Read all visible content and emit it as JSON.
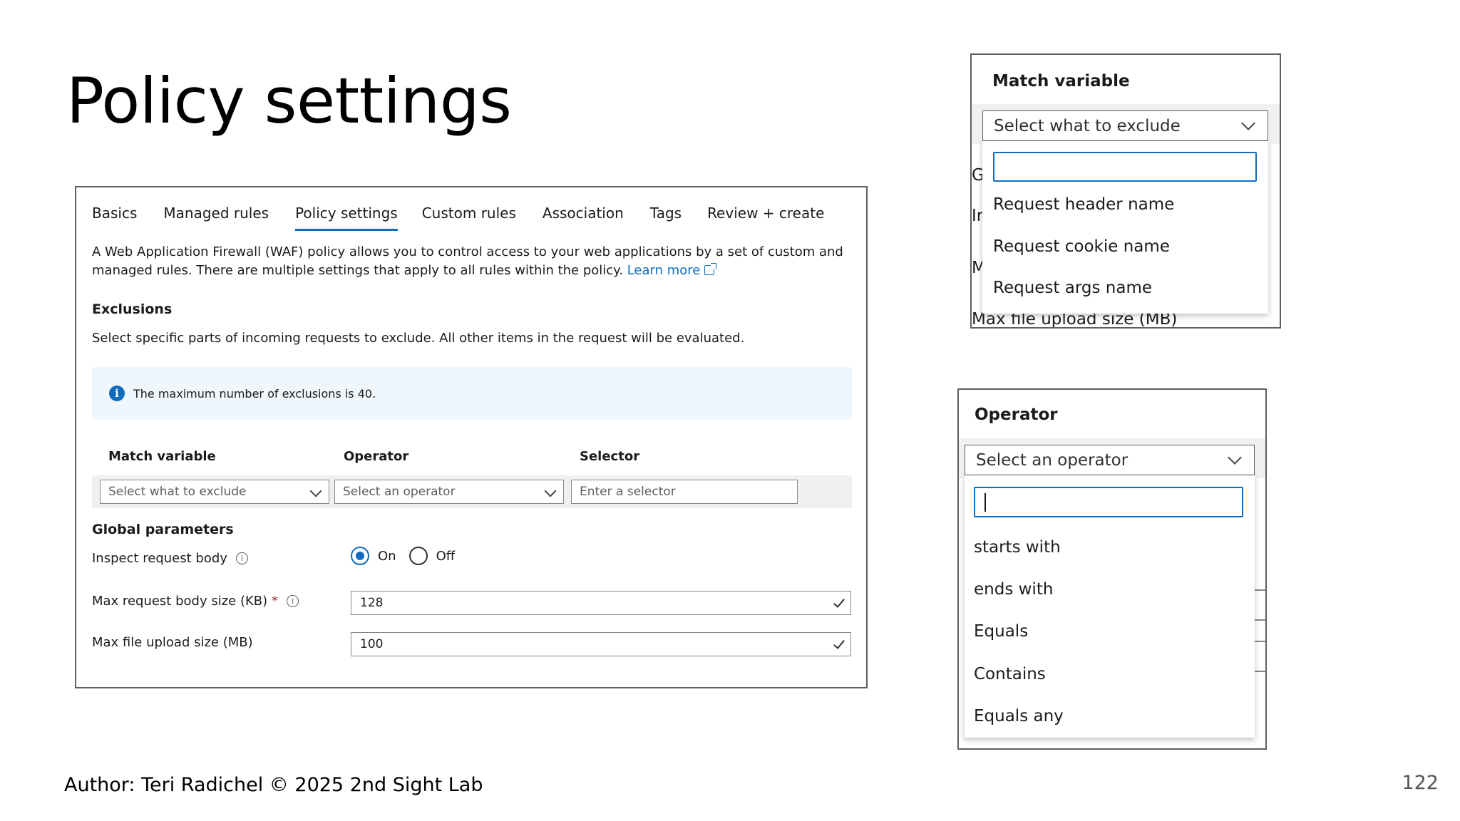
{
  "slide": {
    "title": "Policy settings",
    "author": "Author: Teri Radichel © 2025 2nd Sight Lab",
    "page_number": "122"
  },
  "waf": {
    "tabs": [
      "Basics",
      "Managed rules",
      "Policy settings",
      "Custom rules",
      "Association",
      "Tags",
      "Review + create"
    ],
    "active_tab": "Policy settings",
    "description": "A Web Application Firewall (WAF) policy allows you to control access to your web applications by a set of custom and managed rules. There are multiple settings that apply to all rules within the policy.",
    "learn_more": "Learn more",
    "exclusions": {
      "heading": "Exclusions",
      "text": "Select specific parts of incoming requests to exclude. All other items in the request will be evaluated.",
      "info": "The maximum number of exclusions is 40.",
      "columns": {
        "match_variable": "Match variable",
        "operator": "Operator",
        "selector": "Selector"
      },
      "match_variable_placeholder": "Select what to exclude",
      "operator_placeholder": "Select an operator",
      "selector_placeholder": "Enter a selector"
    },
    "global": {
      "heading": "Global parameters",
      "inspect_label": "Inspect request body",
      "on_label": "On",
      "off_label": "Off",
      "inspect_value": "On",
      "max_body_label": "Max request body size (KB)",
      "required_mark": "*",
      "max_body_value": "128",
      "max_file_label": "Max file upload size (MB)",
      "max_file_value": "100"
    }
  },
  "match_variable_dropdown": {
    "title": "Match variable",
    "placeholder": "Select what to exclude",
    "search_value": "",
    "options": [
      "Request header name",
      "Request cookie name",
      "Request args name"
    ],
    "background_fragments": [
      "G",
      "Ir",
      "M",
      "Max file upload size (MB)"
    ]
  },
  "operator_dropdown": {
    "title": "Operator",
    "placeholder": "Select an operator",
    "search_value": "",
    "options": [
      "starts with",
      "ends with",
      "Equals",
      "Contains",
      "Equals any"
    ]
  },
  "colors": {
    "accent": "#0f6cbd",
    "info_background": "#eff6fc",
    "row_background": "#f0f0f0",
    "required": "#a4262c"
  }
}
